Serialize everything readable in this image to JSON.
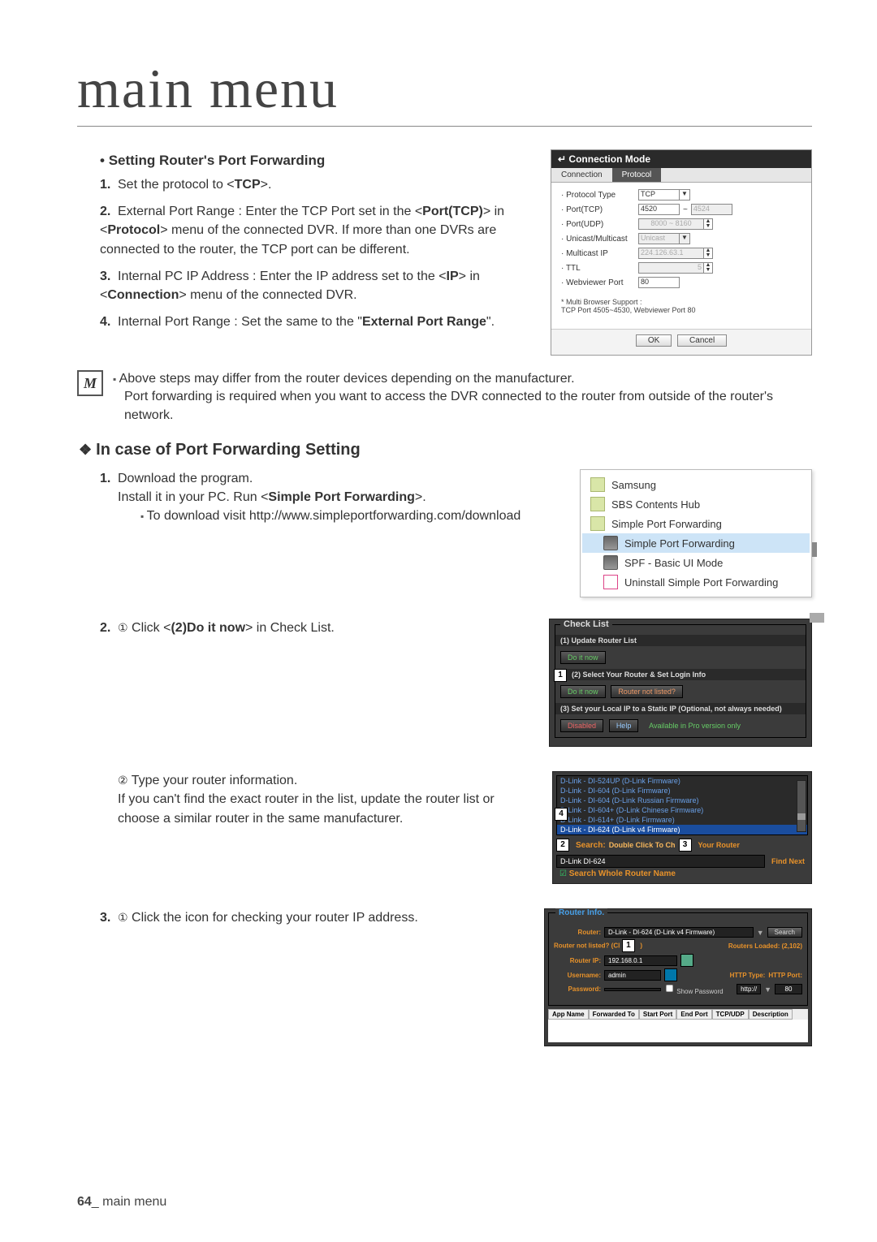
{
  "page_title": "main menu",
  "section1": {
    "heading": "Setting Router's Port Forwarding",
    "items": [
      {
        "n": "1.",
        "html": "Set the protocol to <<b>TCP</b>>."
      },
      {
        "n": "2.",
        "html": "External Port Range : Enter the TCP Port set in the <<b>Port(TCP)</b>> in <<b>Protocol</b>> menu of the connected DVR. If more than one DVRs are connected to the router, the TCP port can be different."
      },
      {
        "n": "3.",
        "html": "Internal PC IP Address : Enter the IP address set to the <<b>IP</b>> in <<b>Connection</b>> menu of the connected DVR."
      },
      {
        "n": "4.",
        "html": "Internal Port Range : Set the same to the \"<b>External Port Range</b>\"."
      }
    ]
  },
  "conn_panel": {
    "title": "Connection Mode",
    "tabs": [
      "Connection",
      "Protocol"
    ],
    "rows": {
      "protocol_type": {
        "label": "Protocol Type",
        "value": "TCP"
      },
      "port_tcp": {
        "label": "Port(TCP)",
        "value": "4520",
        "value2": "4524"
      },
      "port_udp": {
        "label": "Port(UDP)",
        "range": "8000 ~ 8160"
      },
      "unicast": {
        "label": "Unicast/Multicast",
        "value": "Unicast"
      },
      "multicast_ip": {
        "label": "Multicast IP",
        "value": "224.126.63.1"
      },
      "ttl": {
        "label": "TTL",
        "value": "5"
      },
      "webviewer": {
        "label": "Webviewer Port",
        "value": "80"
      }
    },
    "note": "* Multi Browser Support :\n   TCP Port 4505~4530, Webviewer Port 80",
    "buttons": {
      "ok": "OK",
      "cancel": "Cancel"
    },
    "back_icon": "↵"
  },
  "note_block": {
    "lines": [
      "Above steps may differ from the router devices depending on the manufacturer.",
      "Port forwarding is required when you want to access the DVR connected to the router from outside of the router's network."
    ]
  },
  "section2": {
    "heading": "In case of Port Forwarding Setting",
    "step1": {
      "n": "1.",
      "line1": "Download the program.",
      "line2_html": "Install it in your PC. Run <<b>Simple Port Forwarding</b>>.",
      "sub": "To download visit http://www.simpleportforwarding.com/download"
    },
    "startmenu": {
      "items": [
        {
          "text": "Samsung",
          "icon": "folder"
        },
        {
          "text": "SBS Contents Hub",
          "icon": "folder"
        },
        {
          "text": "Simple Port Forwarding",
          "icon": "folder"
        },
        {
          "text": "Simple Port Forwarding",
          "icon": "app",
          "indent": true,
          "hl": true
        },
        {
          "text": "SPF - Basic UI Mode",
          "icon": "app",
          "indent": true
        },
        {
          "text": "Uninstall Simple Port Forwarding",
          "icon": "uninstall",
          "indent": true
        }
      ]
    },
    "step2": {
      "n": "2.",
      "circ": "①",
      "html": "Click <<b>(2)Do it now</b>> in Check List."
    },
    "checklist": {
      "legend": "Check List",
      "r1_title": "(1) Update Router List",
      "r1_btn": "Do it now",
      "r2_title": "(2) Select Your Router & Set Login Info",
      "r2_btn1": "Do it now",
      "r2_btn2": "Router not listed?",
      "r3_title": "(3) Set your Local IP to a Static IP (Optional, not always needed)",
      "r3_btn1": "Disabled",
      "r3_btn2": "Help",
      "r3_note": "Available in Pro version only",
      "marker": "1"
    },
    "step2b": {
      "circ": "②",
      "text": "Type your router information.\nIf you can't find the exact router in the list, update the router list or choose a similar router in the same manufacturer."
    },
    "routersel": {
      "items": [
        "D-Link - DI-524UP (D-Link Firmware)",
        "D-Link - DI-604 (D-Link Firmware)",
        "D-Link - DI-604 (D-Link Russian Firmware)",
        "D-Link - DI-604+ (D-Link Chinese Firmware)",
        "D-Link - DI-614+ (D-Link Firmware)",
        "D-Link - DI-624 (D-Link v4 Firmware)"
      ],
      "selected_index": 5,
      "marker4": "4",
      "search_label": "Search:",
      "marker2": "2",
      "search_value": "D-Link DI-624",
      "dbl": "Double Click To Ch",
      "marker3": "3",
      "your": "Your Router",
      "find_next": "Find Next",
      "chk_label": "Search Whole Router Name"
    },
    "step3": {
      "n": "3.",
      "circ": "①",
      "text": "Click the icon for checking your router IP address."
    },
    "rinfo": {
      "legend": "Router Info.",
      "router_label": "Router:",
      "router_value": "D-Link - DI-624 (D-Link v4 Firmware)",
      "search_btn": "Search",
      "not_listed": "Router not listed? (Cl",
      "marker1": "1",
      "loaded": "Routers Loaded: (2,102)",
      "ip_label": "Router IP:",
      "ip_value": "192.168.0.1",
      "user_label": "Username:",
      "user_value": "admin",
      "pass_label": "Password:",
      "show_pw": "Show Password",
      "http_type": "HTTP Type:",
      "http_val": "http://",
      "http_port_l": "HTTP Port:",
      "http_port_v": "80",
      "table_headers": [
        "App Name",
        "Forwarded To",
        "Start Port",
        "End Port",
        "TCP/UDP",
        "Description"
      ]
    }
  },
  "footer": {
    "page": "64",
    "section": "main menu",
    "sep": "_ "
  }
}
